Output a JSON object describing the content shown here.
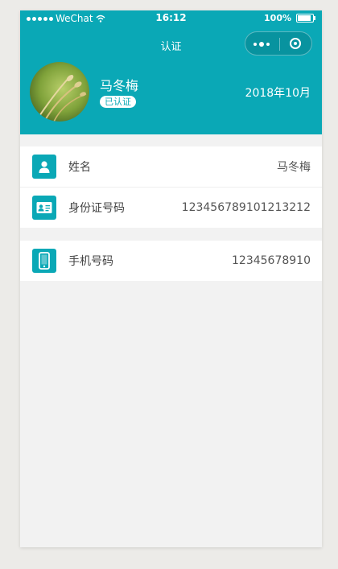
{
  "status_bar": {
    "carrier": "WeChat",
    "time": "16:12",
    "battery": "100%"
  },
  "nav": {
    "title": "认证"
  },
  "profile": {
    "name": "马冬梅",
    "badge": "已认证",
    "date": "2018年10月"
  },
  "info_groups": [
    {
      "rows": [
        {
          "icon": "person-icon",
          "label": "姓名",
          "value": "马冬梅"
        },
        {
          "icon": "id-card-icon",
          "label": "身份证号码",
          "value": "123456789101213212"
        }
      ]
    },
    {
      "rows": [
        {
          "icon": "phone-icon",
          "label": "手机号码",
          "value": "12345678910"
        }
      ]
    }
  ],
  "colors": {
    "accent": "#0aa8b6",
    "page_bg": "#f2f2f2",
    "outer_bg": "#ecebe8"
  }
}
